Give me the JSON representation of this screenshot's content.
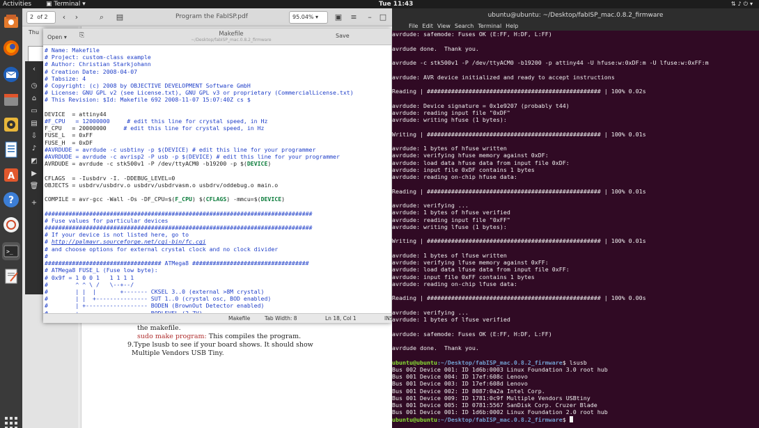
{
  "topbar": {
    "activities": "Activities",
    "app": "Terminal",
    "clock": "Tue 11:43"
  },
  "pdf": {
    "page": "2",
    "page_of": "of 2",
    "title": "Program the FabISP.pdf",
    "zoom": "95.04%",
    "sidebar_label": "Thu",
    "lines": [
      {
        "t": "the makefile.",
        "cls": ""
      },
      {
        "t": "sudo make program: ",
        "cls": "red",
        "rest": "This compiles the program."
      },
      {
        "t": "9.Type lsusb to see if your board shows. It should show",
        "cls": ""
      },
      {
        "t": "  Multiple Vendors USB Tiny.",
        "cls": ""
      }
    ]
  },
  "editor": {
    "open": "Open",
    "title": "Makefile",
    "subtitle": "~/Desktop/fabISP_mac.0.8.2_firmware",
    "save": "Save",
    "status_lang": "Makefile",
    "status_tab": "Tab Width: 8",
    "status_pos": "Ln 18, Col 1",
    "status_ins": "INS"
  },
  "terminal": {
    "title": "ubuntu@ubuntu: ~/Desktop/fabISP_mac.0.8.2_firmware",
    "menu": [
      "File",
      "Edit",
      "View",
      "Search",
      "Terminal",
      "Help"
    ],
    "prompt_user": "ubuntu@ubuntu",
    "prompt_path": ":~/Desktop/fabISP_mac.0.8.2_firmware",
    "lsusb_cmd": "$ lsusb"
  },
  "colors": {
    "terminal_bg": "#300a24",
    "prompt_green": "#8ae234",
    "prompt_blue": "#729fcf",
    "comment_blue": "#1e3ec8"
  }
}
